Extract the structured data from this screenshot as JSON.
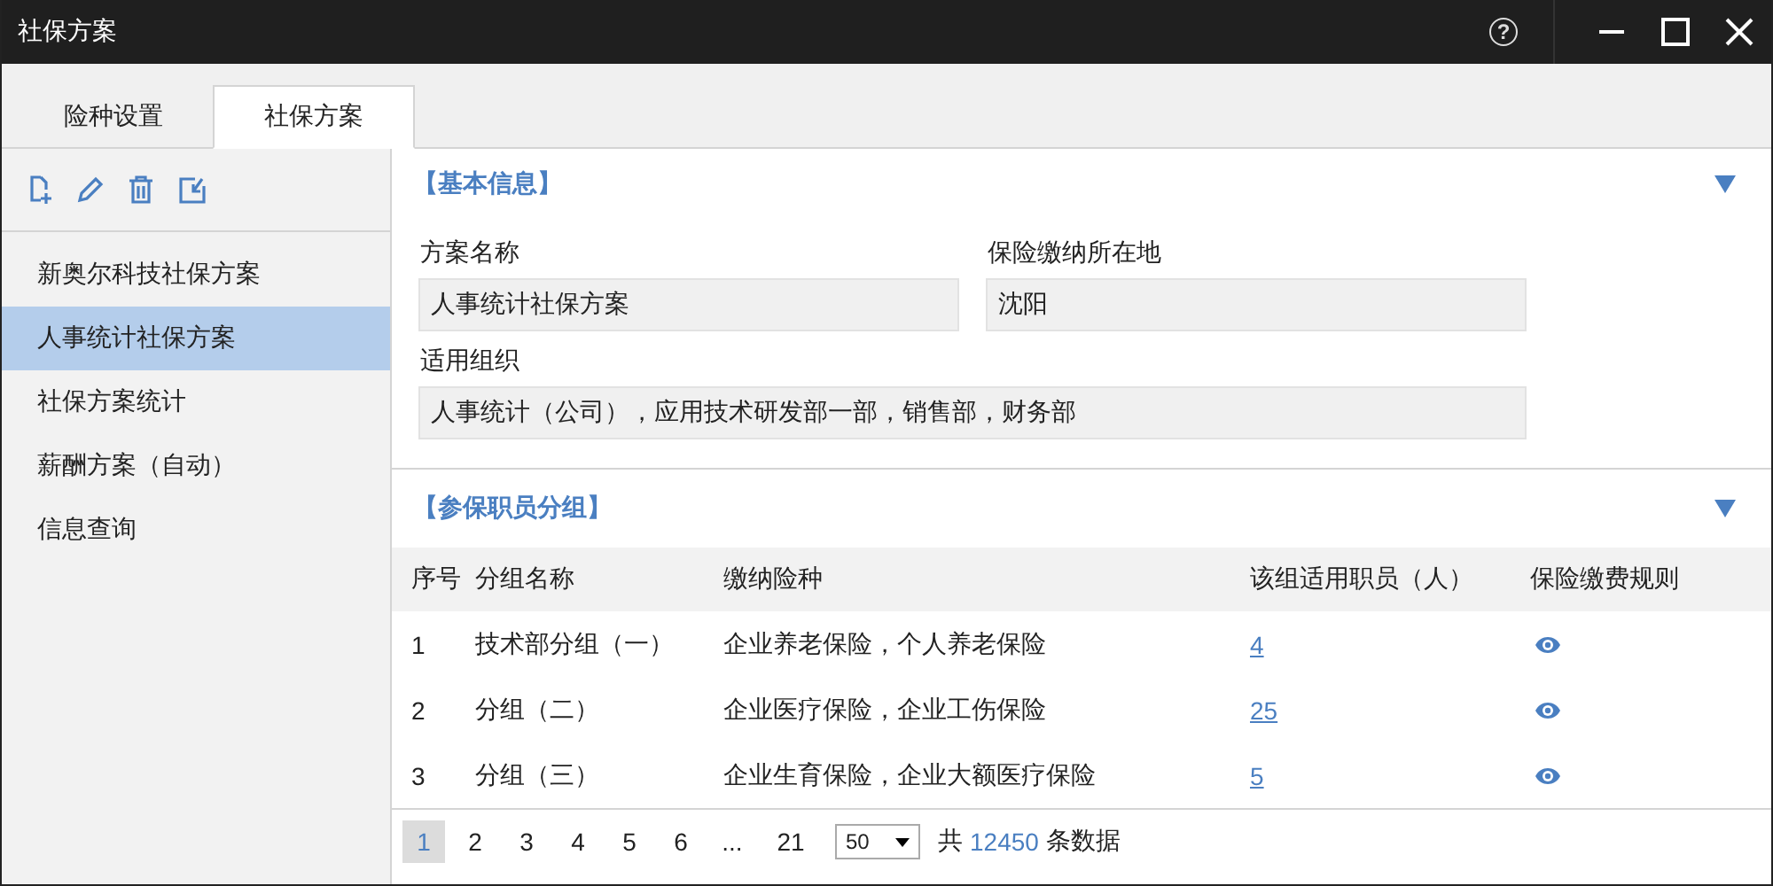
{
  "window": {
    "title": "社保方案",
    "help": "?"
  },
  "tabs": [
    {
      "label": "险种设置",
      "selected": false
    },
    {
      "label": "社保方案",
      "selected": true
    }
  ],
  "sidebar": {
    "items": [
      {
        "label": "新奥尔科技社保方案",
        "selected": false
      },
      {
        "label": "人事统计社保方案",
        "selected": true
      },
      {
        "label": "社保方案统计",
        "selected": false
      },
      {
        "label": "薪酬方案（自动）",
        "selected": false
      },
      {
        "label": "信息查询",
        "selected": false
      }
    ]
  },
  "basic_info": {
    "title": "【基本信息】",
    "expanded": true,
    "fields": [
      {
        "label": "方案名称",
        "value": "人事统计社保方案",
        "wide": false
      },
      {
        "label": "保险缴纳所在地",
        "value": "沈阳",
        "wide": false
      },
      {
        "label": "适用组织",
        "value": "人事统计（公司），应用技术研发部一部，销售部，财务部",
        "wide": true
      }
    ]
  },
  "groups": {
    "title": "【参保职员分组】",
    "expanded": true,
    "columns": [
      "序号",
      "分组名称",
      "缴纳险种",
      "该组适用职员（人）",
      "保险缴费规则"
    ],
    "rows": [
      {
        "no": "1",
        "name": "技术部分组（一）",
        "insurance": "企业养老保险，个人养老保险",
        "count": "4"
      },
      {
        "no": "2",
        "name": "分组（二）",
        "insurance": "企业医疗保险，企业工伤保险",
        "count": "25"
      },
      {
        "no": "3",
        "name": "分组（三）",
        "insurance": "企业生育保险，企业大额医疗保险",
        "count": "5"
      }
    ],
    "pagination": {
      "pages": [
        {
          "label": "1",
          "selected": true
        },
        {
          "label": "2",
          "selected": false
        },
        {
          "label": "3",
          "selected": false
        },
        {
          "label": "4",
          "selected": false
        },
        {
          "label": "5",
          "selected": false
        },
        {
          "label": "6",
          "selected": false
        },
        {
          "label": "...",
          "selected": false
        },
        {
          "label": "21",
          "selected": false
        }
      ],
      "page_size": "50",
      "total_prefix": "共",
      "total": "12450",
      "total_suffix": "条数据"
    }
  }
}
